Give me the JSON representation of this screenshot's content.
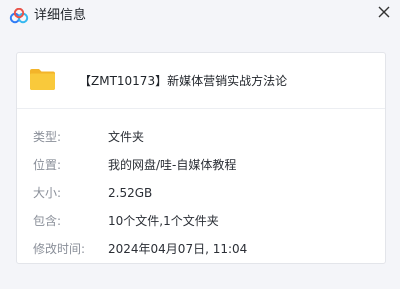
{
  "window": {
    "title": "详细信息"
  },
  "file": {
    "name": "【ZMT10173】新媒体营销实战方法论",
    "icon": "folder-icon",
    "icon_color": "#f9c93b"
  },
  "details": [
    {
      "key": "type",
      "label": "类型:",
      "value": "文件夹"
    },
    {
      "key": "location",
      "label": "位置:",
      "value": "我的网盘/哇-自媒体教程"
    },
    {
      "key": "size",
      "label": "大小:",
      "value": "2.52GB"
    },
    {
      "key": "contains",
      "label": "包含:",
      "value": "10个文件,1个文件夹"
    },
    {
      "key": "modified",
      "label": "修改时间:",
      "value": "2024年04月07日, 11:04"
    }
  ]
}
